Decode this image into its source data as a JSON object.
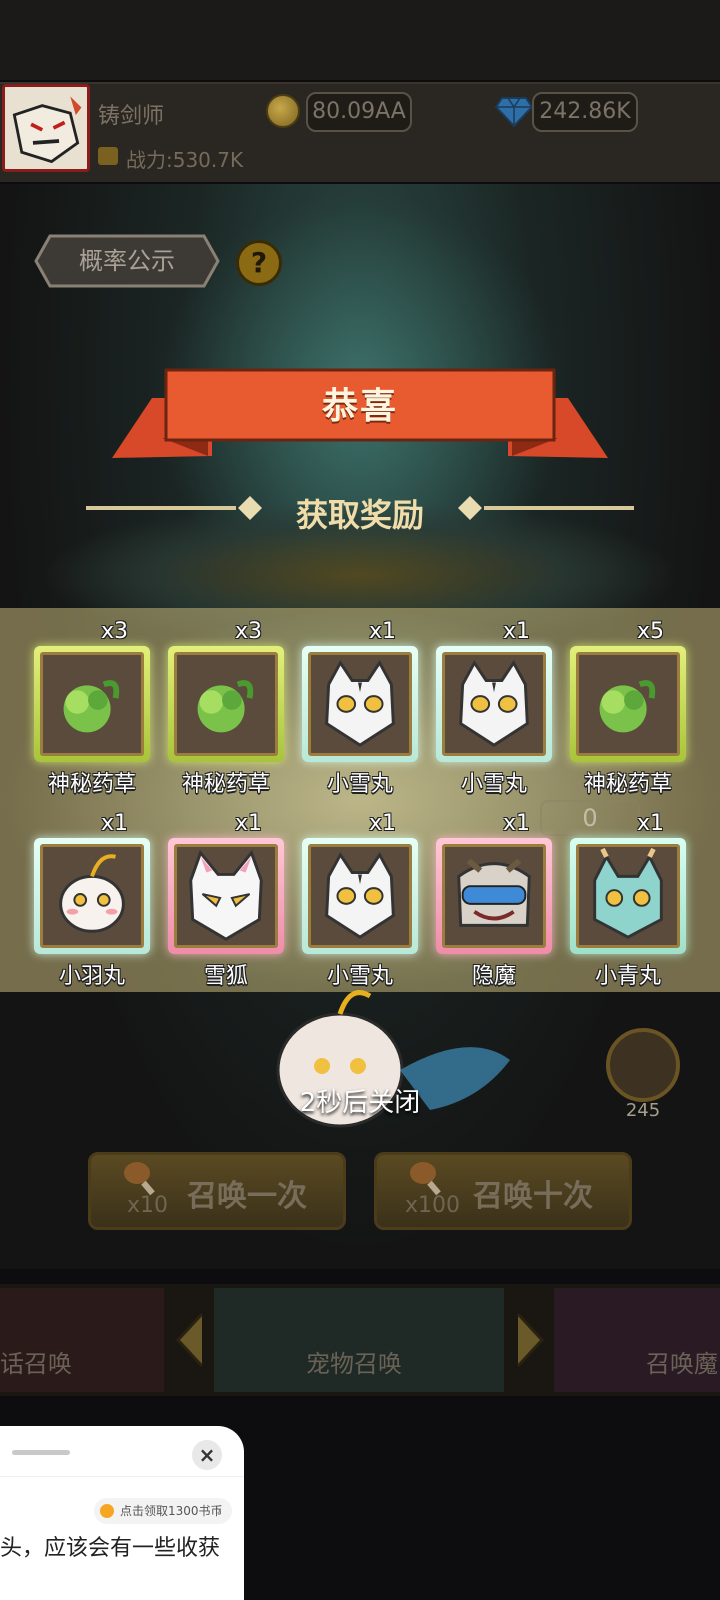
{
  "player": {
    "name": "铸剑师",
    "power": "战力:530.7K",
    "gold": "80.09AA",
    "gems": "242.86K"
  },
  "probability_button": "概率公示",
  "help_icon_glyph": "?",
  "banner_title": "恭喜",
  "reward_header": "获取奖励",
  "rewards_row1": [
    {
      "name": "神秘药草",
      "qty": "x3",
      "rarity_color": "#c8e060",
      "icon": "herb-icon"
    },
    {
      "name": "神秘药草",
      "qty": "x3",
      "rarity_color": "#c8e060",
      "icon": "herb-icon"
    },
    {
      "name": "小雪丸",
      "qty": "x1",
      "rarity_color": "#cfeee4",
      "icon": "white-cat-icon"
    },
    {
      "name": "小雪丸",
      "qty": "x1",
      "rarity_color": "#cfeee4",
      "icon": "white-cat-icon"
    },
    {
      "name": "神秘药草",
      "qty": "x5",
      "rarity_color": "#c8e060",
      "icon": "herb-icon"
    }
  ],
  "rewards_row2": [
    {
      "name": "小羽丸",
      "qty": "x1",
      "rarity_color": "#cfeee4",
      "icon": "feather-cat-icon"
    },
    {
      "name": "雪狐",
      "qty": "x1",
      "rarity_color": "#f3a4bb",
      "icon": "snow-fox-icon"
    },
    {
      "name": "小雪丸",
      "qty": "x1",
      "rarity_color": "#cfeee4",
      "icon": "white-cat-icon"
    },
    {
      "name": "隐魔",
      "qty": "x1",
      "rarity_color": "#f3a4bb",
      "icon": "hidden-demon-icon"
    },
    {
      "name": "小青丸",
      "qty": "x1",
      "rarity_color": "#bde8d8",
      "icon": "teal-dragon-icon"
    }
  ],
  "background_counter": "0",
  "close_countdown": "2秒后关闭",
  "herb_stock": "245",
  "summon_once": {
    "label": "召唤一次",
    "cost": "x10"
  },
  "summon_ten": {
    "label": "召唤十次",
    "cost": "x100"
  },
  "tabs": {
    "left": "话召唤",
    "center": "宠物召唤",
    "right": "召唤魔"
  },
  "sheet": {
    "coin_pill": "点击领取1300书币",
    "close_glyph": "×",
    "text": "头，应该会有一些收获"
  }
}
